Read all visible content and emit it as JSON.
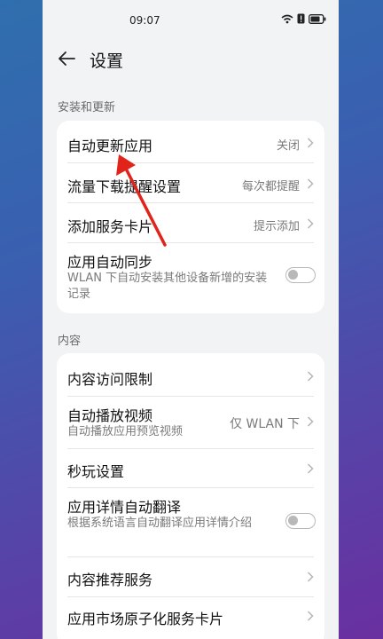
{
  "status_bar": {
    "time": "09:07"
  },
  "header": {
    "title": "设置"
  },
  "sections": {
    "install": {
      "label": "安装和更新",
      "rows": [
        {
          "title": "自动更新应用",
          "value": "关闭"
        },
        {
          "title": "流量下载提醒设置",
          "value": "每次都提醒"
        },
        {
          "title": "添加服务卡片",
          "value": "提示添加"
        },
        {
          "title": "应用自动同步",
          "subtitle": "WLAN 下自动安装其他设备新增的安装记录",
          "toggle": false
        }
      ]
    },
    "content": {
      "label": "内容",
      "rows": [
        {
          "title": "内容访问限制"
        },
        {
          "title": "自动播放视频",
          "subtitle": "自动播放应用预览视频",
          "value": "仅 WLAN 下"
        },
        {
          "title": "秒玩设置"
        },
        {
          "title": "应用详情自动翻译",
          "subtitle": "根据系统语言自动翻译应用详情介绍",
          "toggle": false
        },
        {
          "title": "内容推荐服务"
        },
        {
          "title": "应用市场原子化服务卡片"
        }
      ]
    }
  },
  "colors": {
    "annotation_arrow": "#e2231a"
  }
}
